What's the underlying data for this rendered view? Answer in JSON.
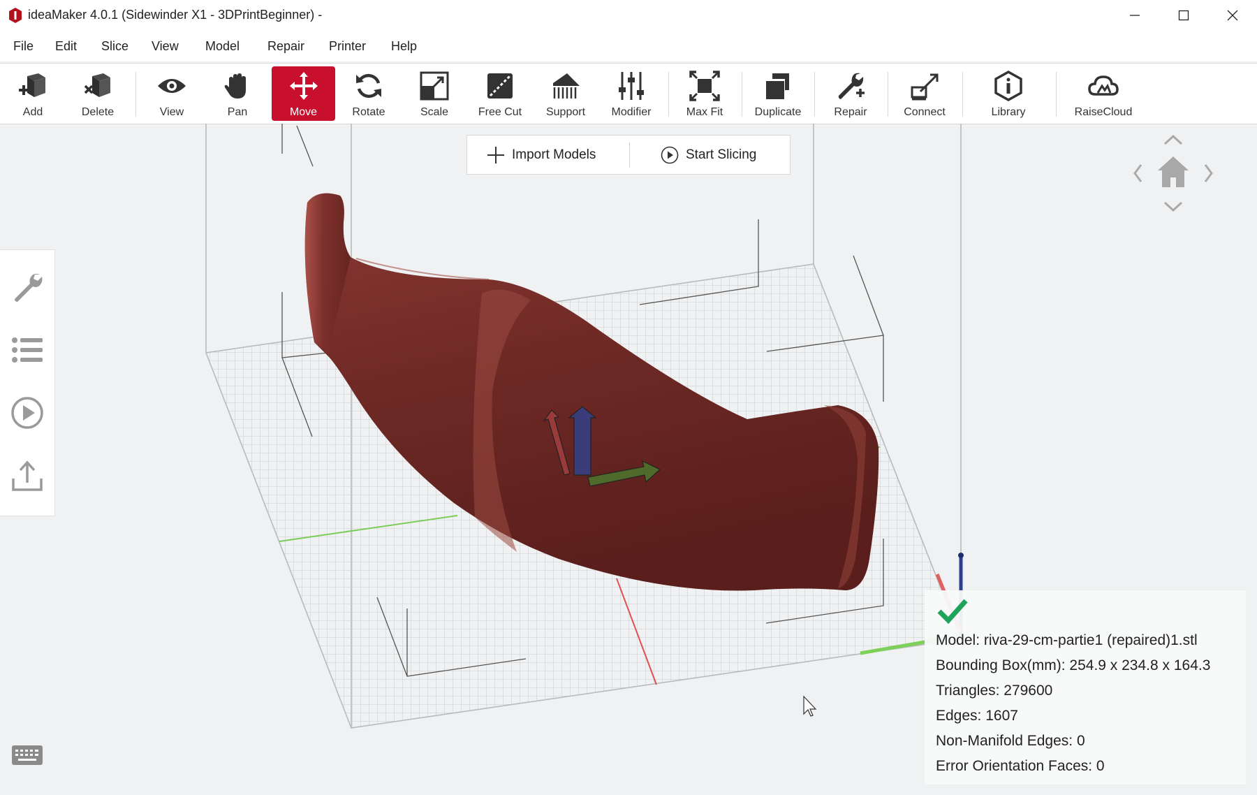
{
  "window": {
    "title": "ideaMaker 4.0.1 (Sidewinder X1 - 3DPrintBeginner) -",
    "controls": {
      "minimize": "minimize-icon",
      "maximize": "maximize-icon",
      "close": "close-icon"
    }
  },
  "menu": [
    "File",
    "Edit",
    "Slice",
    "View",
    "Model",
    "Repair",
    "Printer",
    "Help"
  ],
  "toolbar": {
    "active": "Move",
    "accent_color": "#c8102e",
    "items": [
      {
        "label": "Add",
        "icon": "add-cube-icon"
      },
      {
        "label": "Delete",
        "icon": "delete-cube-icon"
      },
      {
        "label": "View",
        "icon": "eye-icon"
      },
      {
        "label": "Pan",
        "icon": "hand-icon"
      },
      {
        "label": "Move",
        "icon": "move-arrows-icon"
      },
      {
        "label": "Rotate",
        "icon": "rotate-icon"
      },
      {
        "label": "Scale",
        "icon": "scale-icon"
      },
      {
        "label": "Free Cut",
        "icon": "cut-icon"
      },
      {
        "label": "Support",
        "icon": "support-icon"
      },
      {
        "label": "Modifier",
        "icon": "sliders-icon"
      },
      {
        "label": "Max Fit",
        "icon": "max-fit-icon"
      },
      {
        "label": "Duplicate",
        "icon": "duplicate-icon"
      },
      {
        "label": "Repair",
        "icon": "wrench-plus-icon"
      },
      {
        "label": "Connect",
        "icon": "connect-icon"
      },
      {
        "label": "Library",
        "icon": "info-hexagon-icon"
      },
      {
        "label": "RaiseCloud",
        "icon": "cloud-icon"
      }
    ]
  },
  "actions": {
    "import_label": "Import Models",
    "slice_label": "Start Slicing"
  },
  "side_panel": [
    "wrench-icon",
    "list-icon",
    "play-circle-icon",
    "export-icon"
  ],
  "model_color": "#7a2d2a",
  "info": {
    "status_icon": "check-icon",
    "model": "Model: riva-29-cm-partie1 (repaired)1.stl",
    "bounding_box": "Bounding Box(mm): 254.9 x 234.8 x 164.3",
    "triangles": "Triangles: 279600",
    "edges": "Edges: 1607",
    "non_manifold": "Non-Manifold Edges: 0",
    "error_faces": "Error Orientation Faces: 0"
  }
}
